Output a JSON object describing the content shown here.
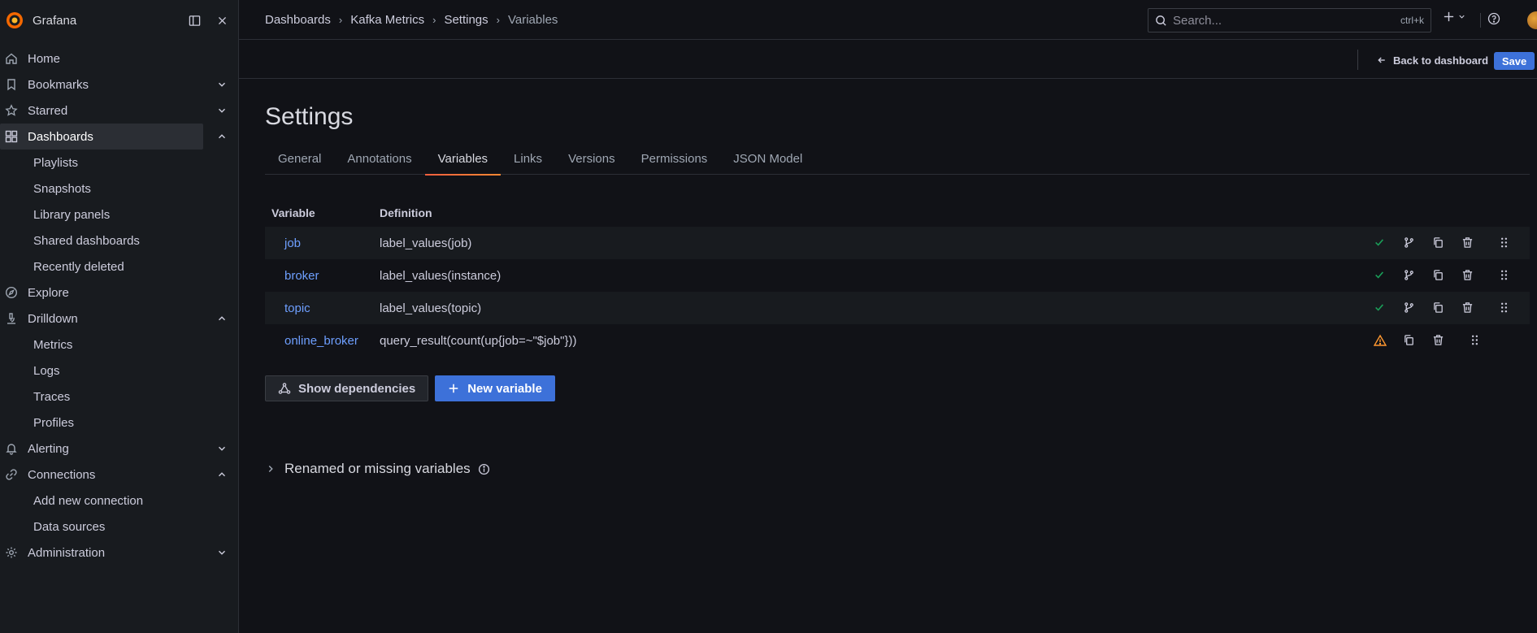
{
  "app": {
    "brand": "Grafana"
  },
  "sidebar": {
    "items": [
      {
        "label": "Home",
        "icon": "home-icon"
      },
      {
        "label": "Bookmarks",
        "icon": "bookmark-icon",
        "chevron": "down"
      },
      {
        "label": "Starred",
        "icon": "star-icon",
        "chevron": "down"
      },
      {
        "label": "Dashboards",
        "icon": "apps-icon",
        "chevron": "up",
        "active": true
      },
      {
        "label": "Playlists",
        "sub": true
      },
      {
        "label": "Snapshots",
        "sub": true
      },
      {
        "label": "Library panels",
        "sub": true
      },
      {
        "label": "Shared dashboards",
        "sub": true
      },
      {
        "label": "Recently deleted",
        "sub": true
      },
      {
        "label": "Explore",
        "icon": "compass-icon"
      },
      {
        "label": "Drilldown",
        "icon": "microscope-icon",
        "chevron": "up"
      },
      {
        "label": "Metrics",
        "sub": true
      },
      {
        "label": "Logs",
        "sub": true
      },
      {
        "label": "Traces",
        "sub": true
      },
      {
        "label": "Profiles",
        "sub": true
      },
      {
        "label": "Alerting",
        "icon": "bell-icon",
        "chevron": "down"
      },
      {
        "label": "Connections",
        "icon": "link-icon",
        "chevron": "up"
      },
      {
        "label": "Add new connection",
        "sub": true
      },
      {
        "label": "Data sources",
        "sub": true
      },
      {
        "label": "Administration",
        "icon": "cog-icon",
        "chevron": "down"
      }
    ]
  },
  "breadcrumb": [
    "Dashboards",
    "Kafka Metrics",
    "Settings",
    "Variables"
  ],
  "search": {
    "placeholder": "Search...",
    "shortcut": "ctrl+k"
  },
  "actionbar": {
    "back_label": "Back to dashboard",
    "save_label": "Save"
  },
  "page": {
    "title": "Settings"
  },
  "tabs": [
    "General",
    "Annotations",
    "Variables",
    "Links",
    "Versions",
    "Permissions",
    "JSON Model"
  ],
  "active_tab": "Variables",
  "table": {
    "headers": {
      "variable": "Variable",
      "definition": "Definition"
    },
    "rows": [
      {
        "name": "job",
        "definition": "label_values(job)",
        "status": "ok"
      },
      {
        "name": "broker",
        "definition": "label_values(instance)",
        "status": "ok"
      },
      {
        "name": "topic",
        "definition": "label_values(topic)",
        "status": "ok"
      },
      {
        "name": "online_broker",
        "definition": "query_result(count(up{job=~\"$job\"}))",
        "status": "warning"
      }
    ]
  },
  "buttons": {
    "show_dependencies": "Show dependencies",
    "new_variable": "New variable"
  },
  "renamed": {
    "label": "Renamed or missing variables"
  },
  "colors": {
    "accent": "#3d71d9",
    "link": "#6e9fff",
    "ok": "#1a9f59",
    "warning": "#ff9830",
    "tab_underline": "#ff8833"
  }
}
